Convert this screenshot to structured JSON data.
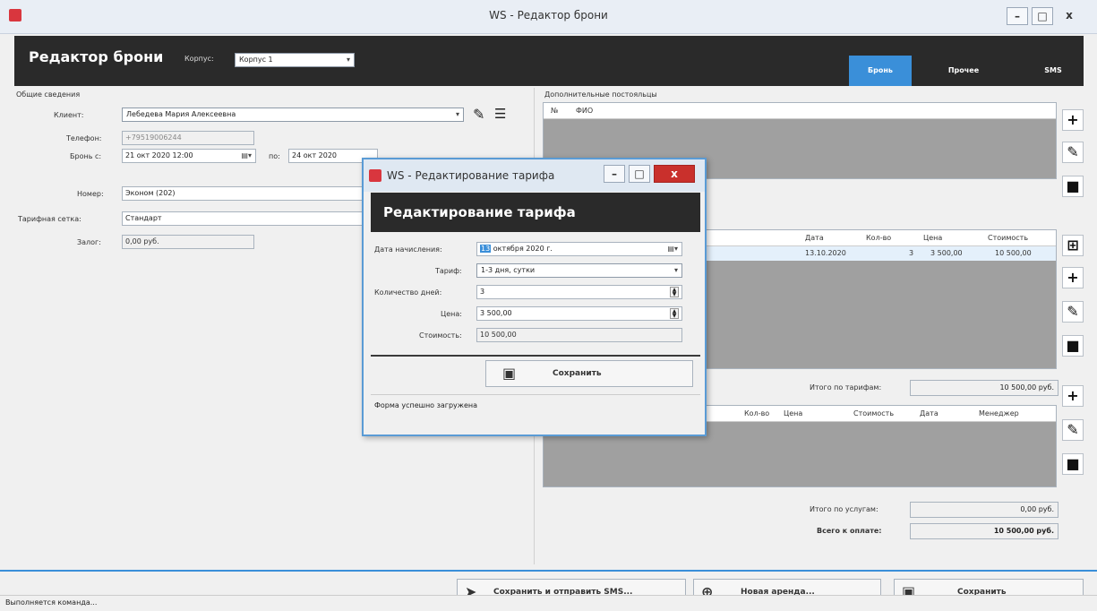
{
  "window": {
    "title": "WS - Редактор брони"
  },
  "header": {
    "title": "Редактор брони",
    "building_label": "Корпус:",
    "building_value": "Корпус 1",
    "tabs": [
      {
        "label": "Бронь",
        "active": true
      },
      {
        "label": "Прочее",
        "active": false
      },
      {
        "label": "SMS",
        "active": false
      }
    ]
  },
  "general": {
    "section_label": "Общие сведения",
    "client_label": "Клиент:",
    "client_value": "Лебедева Мария Алексеевна",
    "phone_label": "Телефон:",
    "phone_value": "+79519006244",
    "booking_from_label": "Бронь с:",
    "booking_from_value": "21 окт 2020 12:00",
    "to_label": "по:",
    "to_value": "24 окт 2020",
    "room_label": "Номер:",
    "room_value": "Эконом (202)",
    "tariff_grid_label": "Тарифная сетка:",
    "tariff_grid_value": "Стандарт",
    "deposit_label": "Залог:",
    "deposit_value": "0,00 руб."
  },
  "guests": {
    "section_label": "Дополнительные постояльцы",
    "columns": [
      "№",
      "ФИО"
    ]
  },
  "tariffs": {
    "columns": [
      "Дата",
      "Кол-во",
      "Цена",
      "Стоимость"
    ],
    "rows": [
      {
        "date": "13.10.2020",
        "qty": "3",
        "price": "3 500,00",
        "cost": "10 500,00"
      }
    ],
    "total_label": "Итого по тарифам:",
    "total_value": "10 500,00 руб."
  },
  "services": {
    "columns": [
      "Кол-во",
      "Цена",
      "Стоимость",
      "Дата",
      "Менеджер"
    ],
    "total_label": "Итого по услугам:",
    "total_value": "0,00 руб.",
    "grand_label": "Всего к оплате:",
    "grand_value": "10 500,00 руб."
  },
  "footer": {
    "save_sms_label": "Сохранить и отправить SMS...",
    "new_rent_label": "Новая аренда...",
    "save_label": "Сохранить"
  },
  "status": {
    "text": "Выполняется команда..."
  },
  "dialog": {
    "title": "WS - Редактирование тарифа",
    "header": "Редактирование тарифа",
    "start_date_label": "Дата начисления:",
    "start_date_day": "13",
    "start_date_value": "октября  2020 г.",
    "tariff_label": "Тариф:",
    "tariff_value": "1-3 дня, сутки",
    "days_label": "Количество дней:",
    "days_value": "3",
    "price_label": "Цена:",
    "price_value": "3 500,00",
    "cost_label": "Стоимость:",
    "cost_value": "10 500,00",
    "save_label": "Сохранить",
    "status": "Форма успешно загружена"
  },
  "colors": {
    "accent": "#3a8fd9",
    "header_bg": "#2a2a2a",
    "close_red": "#c9302c"
  }
}
